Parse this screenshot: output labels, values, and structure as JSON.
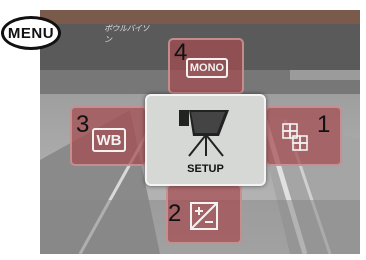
{
  "menu_badge": {
    "label": "MENU"
  },
  "center": {
    "label": "SETUP",
    "icon": "setup-camera-icon"
  },
  "options": {
    "color_mode": {
      "number": "4",
      "icon_text": "MONO"
    },
    "white_balance": {
      "number": "3",
      "icon_text": "WB"
    },
    "drive_mode": {
      "number": "1",
      "icon": "grid-squares-icon"
    },
    "exposure_compensation": {
      "number": "2",
      "icon": "plus-minus-icon"
    }
  },
  "background_sign": {
    "text": "ボウルバイソン"
  },
  "colors": {
    "tile": "#a54b50",
    "center_tile": "#d6d8d5",
    "icon": "#f2f2f2"
  }
}
